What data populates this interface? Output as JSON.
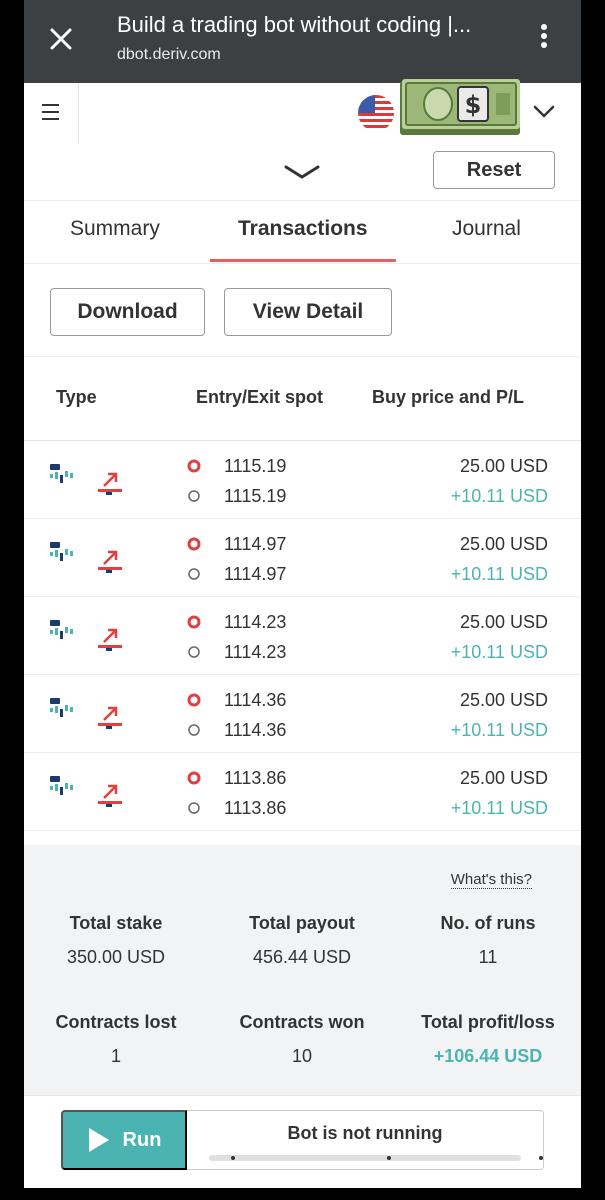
{
  "browser": {
    "title": "Build a trading bot without coding |...",
    "url": "dbot.deriv.com"
  },
  "toolbar": {
    "reset_label": "Reset"
  },
  "tabs": [
    {
      "label": "Summary",
      "active": false
    },
    {
      "label": "Transactions",
      "active": true
    },
    {
      "label": "Journal",
      "active": false
    }
  ],
  "actions": {
    "download_label": "Download",
    "view_detail_label": "View Detail"
  },
  "table": {
    "headers": {
      "type": "Type",
      "spot": "Entry/Exit spot",
      "price": "Buy price and P/L"
    },
    "rows": [
      {
        "entry": "1115.19",
        "exit": "1115.19",
        "buy_price": "25.00 USD",
        "pl": "+10.11 USD"
      },
      {
        "entry": "1114.97",
        "exit": "1114.97",
        "buy_price": "25.00 USD",
        "pl": "+10.11 USD"
      },
      {
        "entry": "1114.23",
        "exit": "1114.23",
        "buy_price": "25.00 USD",
        "pl": "+10.11 USD"
      },
      {
        "entry": "1114.36",
        "exit": "1114.36",
        "buy_price": "25.00 USD",
        "pl": "+10.11 USD"
      },
      {
        "entry": "1113.86",
        "exit": "1113.86",
        "buy_price": "25.00 USD",
        "pl": "+10.11 USD"
      }
    ]
  },
  "summary": {
    "whats_this": "What's this?",
    "total_stake_label": "Total stake",
    "total_stake": "350.00 USD",
    "total_payout_label": "Total payout",
    "total_payout": "456.44 USD",
    "runs_label": "No. of runs",
    "runs": "11",
    "lost_label": "Contracts lost",
    "lost": "1",
    "won_label": "Contracts won",
    "won": "10",
    "profit_label": "Total profit/loss",
    "profit": "+106.44 USD"
  },
  "runbar": {
    "run_label": "Run",
    "status": "Bot is not running"
  },
  "colors": {
    "accent": "#4bb4b3",
    "tab_underline": "#e06060",
    "loss_marker": "#e04040",
    "browser_bar": "#3c4043"
  },
  "icons": [
    "close-icon",
    "kebab-menu-icon",
    "hamburger-icon",
    "us-flag-icon",
    "money-icon",
    "chevron-down-icon",
    "asset-icon",
    "rise-arrow-icon",
    "entry-marker-icon",
    "exit-marker-icon",
    "play-icon"
  ]
}
